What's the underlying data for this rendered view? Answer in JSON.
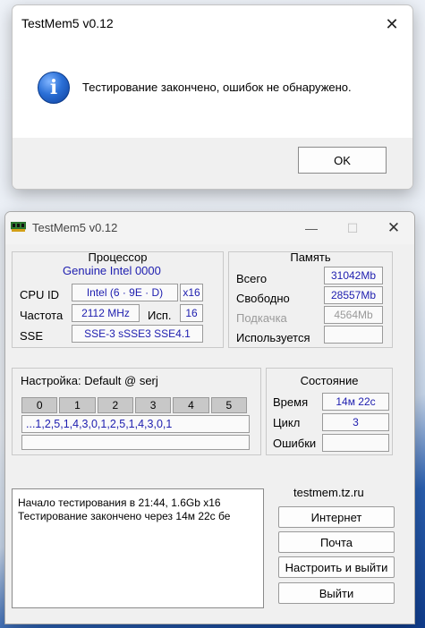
{
  "dialog": {
    "title": "TestMem5 v0.12",
    "close_glyph": "✕",
    "icon": "info-icon",
    "icon_glyph": "i",
    "message": "Тестирование закончено, ошибок не обнаружено.",
    "ok_label": "OK"
  },
  "window": {
    "title": "TestMem5 v0.12",
    "icon": "memory-module-icon",
    "minimize_glyph": "—",
    "maximize_glyph": "☐",
    "close_glyph": "✕"
  },
  "processor": {
    "title": "Процессор",
    "name": "Genuine Intel  0000",
    "cpu_id_label": "CPU ID",
    "cpu_id_value": "Intel  (6 · 9E · D)",
    "cpu_mult": "x16",
    "freq_label": "Частота",
    "freq_value": "2112 MHz",
    "used_label": "Исп.",
    "used_value": "16",
    "sse_label": "SSE",
    "sse_value": "SSE-3 sSSE3 SSE4.1"
  },
  "memory": {
    "title": "Память",
    "total_label": "Всего",
    "total_value": "31042Mb",
    "free_label": "Свободно",
    "free_value": "28557Mb",
    "swap_label": "Подкачка",
    "swap_value": "4564Mb",
    "used_label": "Используется",
    "used_value": ""
  },
  "settings": {
    "title": "Настройка: Default @ serj",
    "tabs": [
      "0",
      "1",
      "2",
      "3",
      "4",
      "5"
    ],
    "sequence": "...1,2,5,1,4,3,0,1,2,5,1,4,3,0,1",
    "progress": ""
  },
  "status": {
    "title": "Состояние",
    "time_label": "Время",
    "time_value": "14м 22с",
    "cycle_label": "Цикл",
    "cycle_value": "3",
    "errors_label": "Ошибки",
    "errors_value": ""
  },
  "log": {
    "lines": [
      "Начало тестирования в 21:44, 1.6Gb x16",
      "Тестирование закончено через 14м 22с бе"
    ]
  },
  "links": {
    "site": "testmem.tz.ru",
    "internet_label": "Интернет",
    "mail_label": "Почта",
    "configure_exit_label": "Настроить и выйти",
    "exit_label": "Выйти"
  }
}
